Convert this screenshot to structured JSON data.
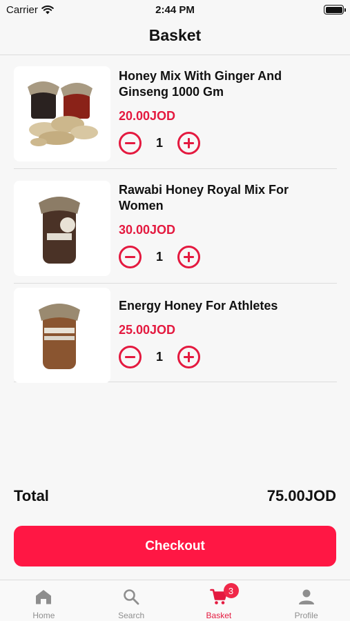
{
  "status_bar": {
    "carrier": "Carrier",
    "time": "2:44 PM"
  },
  "nav": {
    "title": "Basket"
  },
  "basket": {
    "items": [
      {
        "name": "Honey Mix With Ginger And Ginseng 1000 Gm",
        "price": "20.00JOD",
        "quantity": "1"
      },
      {
        "name": "Rawabi Honey Royal Mix For Women",
        "price": "30.00JOD",
        "quantity": "1"
      },
      {
        "name": "Energy Honey For Athletes",
        "price": "25.00JOD",
        "quantity": "1"
      }
    ]
  },
  "summary": {
    "total_label": "Total",
    "total_value": "75.00JOD"
  },
  "checkout": {
    "label": "Checkout"
  },
  "tabs": [
    {
      "label": "Home",
      "icon": "home-icon"
    },
    {
      "label": "Search",
      "icon": "search-icon"
    },
    {
      "label": "Basket",
      "icon": "cart-icon",
      "badge": "3"
    },
    {
      "label": "Profile",
      "icon": "profile-icon"
    }
  ],
  "colors": {
    "accent": "#e4193f",
    "checkout": "#ff1744",
    "badge": "#f02849",
    "tab_inactive": "#8e8e8e"
  }
}
